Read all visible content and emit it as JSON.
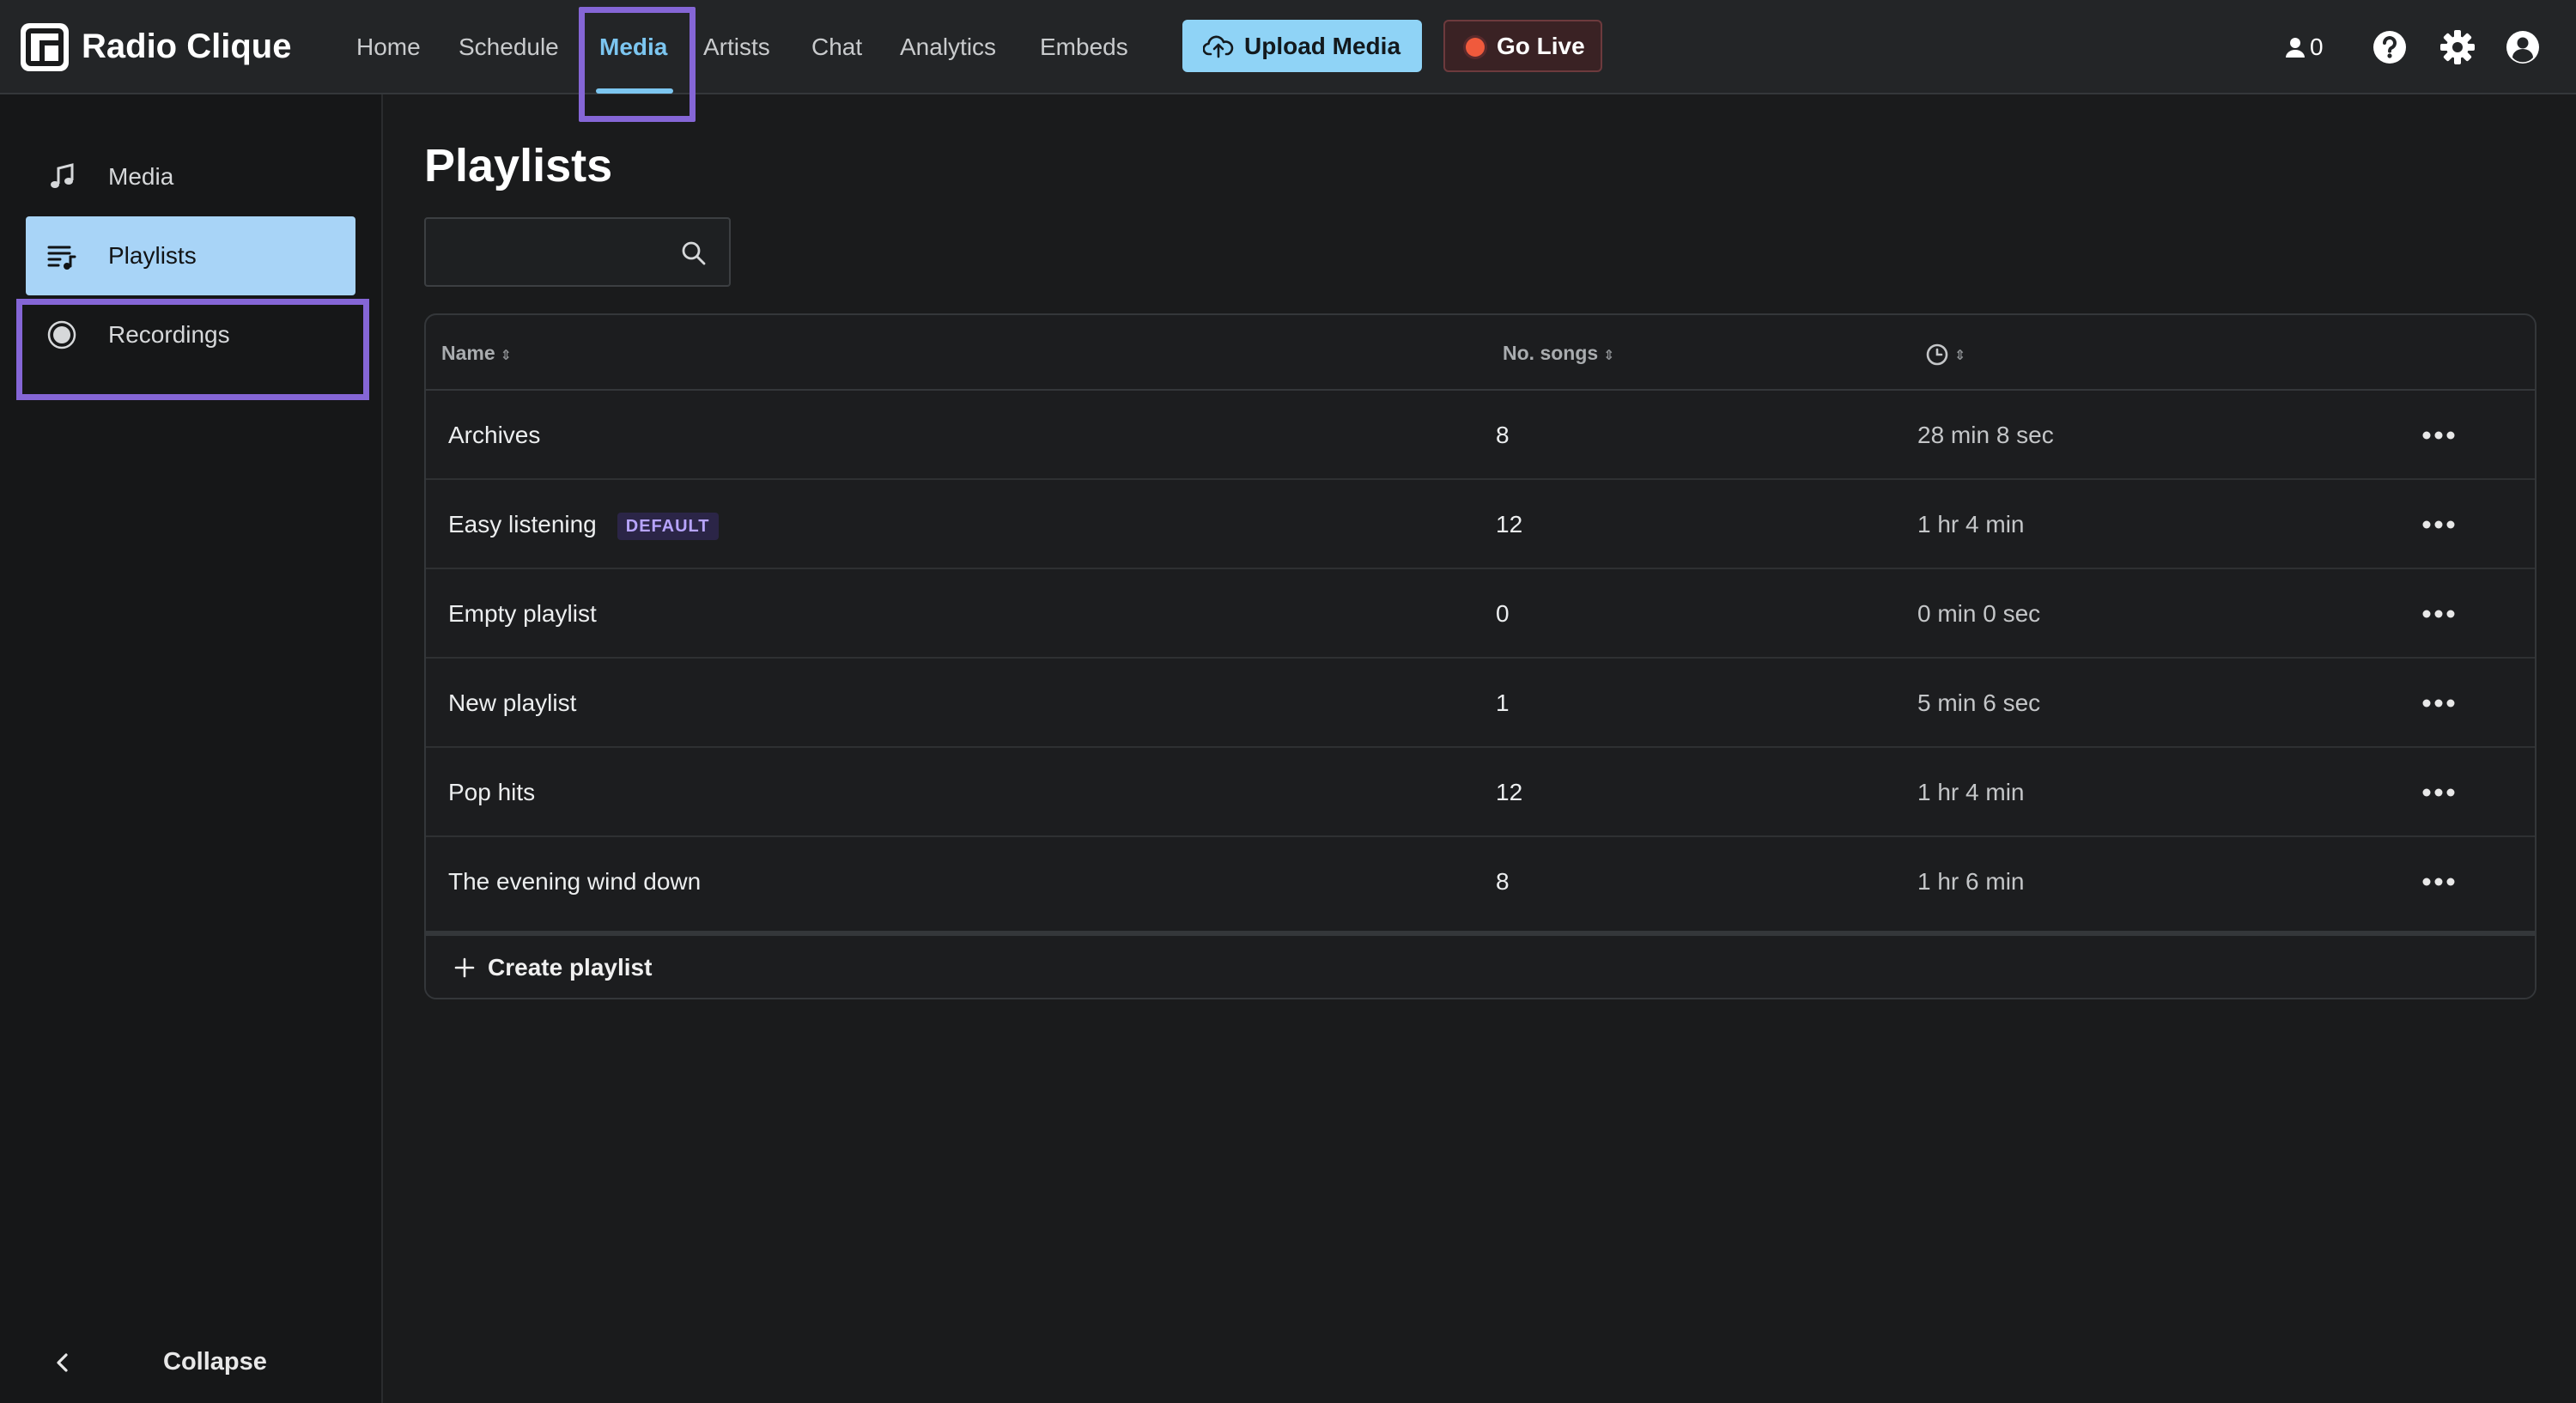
{
  "app": {
    "name": "Radio Clique"
  },
  "nav": {
    "items": [
      {
        "label": "Home"
      },
      {
        "label": "Schedule"
      },
      {
        "label": "Media"
      },
      {
        "label": "Artists"
      },
      {
        "label": "Chat"
      },
      {
        "label": "Analytics"
      },
      {
        "label": "Embeds"
      }
    ],
    "active": "Media",
    "upload_label": "Upload Media",
    "golive_label": "Go Live",
    "listener_count": "0",
    "icons": [
      "user-icon",
      "help-icon",
      "gear-icon",
      "account-icon"
    ]
  },
  "sidebar": {
    "items": [
      {
        "label": "Media",
        "icon": "music-note-icon"
      },
      {
        "label": "Playlists",
        "icon": "playlist-icon"
      },
      {
        "label": "Recordings",
        "icon": "record-icon"
      }
    ],
    "active": "Playlists",
    "collapse_label": "Collapse"
  },
  "main": {
    "title": "Playlists",
    "search_value": "",
    "search_placeholder": "",
    "columns": {
      "name": "Name",
      "songs": "No. songs",
      "duration_icon": "clock-icon"
    },
    "rows": [
      {
        "name": "Archives",
        "badge": "",
        "songs": "8",
        "duration": "28 min 8 sec"
      },
      {
        "name": "Easy listening",
        "badge": "DEFAULT",
        "songs": "12",
        "duration": "1 hr 4 min"
      },
      {
        "name": "Empty playlist",
        "badge": "",
        "songs": "0",
        "duration": "0 min 0 sec"
      },
      {
        "name": "New playlist",
        "badge": "",
        "songs": "1",
        "duration": "5 min 6 sec"
      },
      {
        "name": "Pop hits",
        "badge": "",
        "songs": "12",
        "duration": "1 hr 4 min"
      },
      {
        "name": "The evening wind down",
        "badge": "",
        "songs": "8",
        "duration": "1 hr 6 min"
      }
    ],
    "create_label": "Create playlist"
  },
  "colors": {
    "accent": "#7cc6f0",
    "highlight": "#8566d6",
    "upload_bg": "#8fd3f6",
    "live_dot": "#f05a3c",
    "badge_text": "#b7a4ff"
  }
}
